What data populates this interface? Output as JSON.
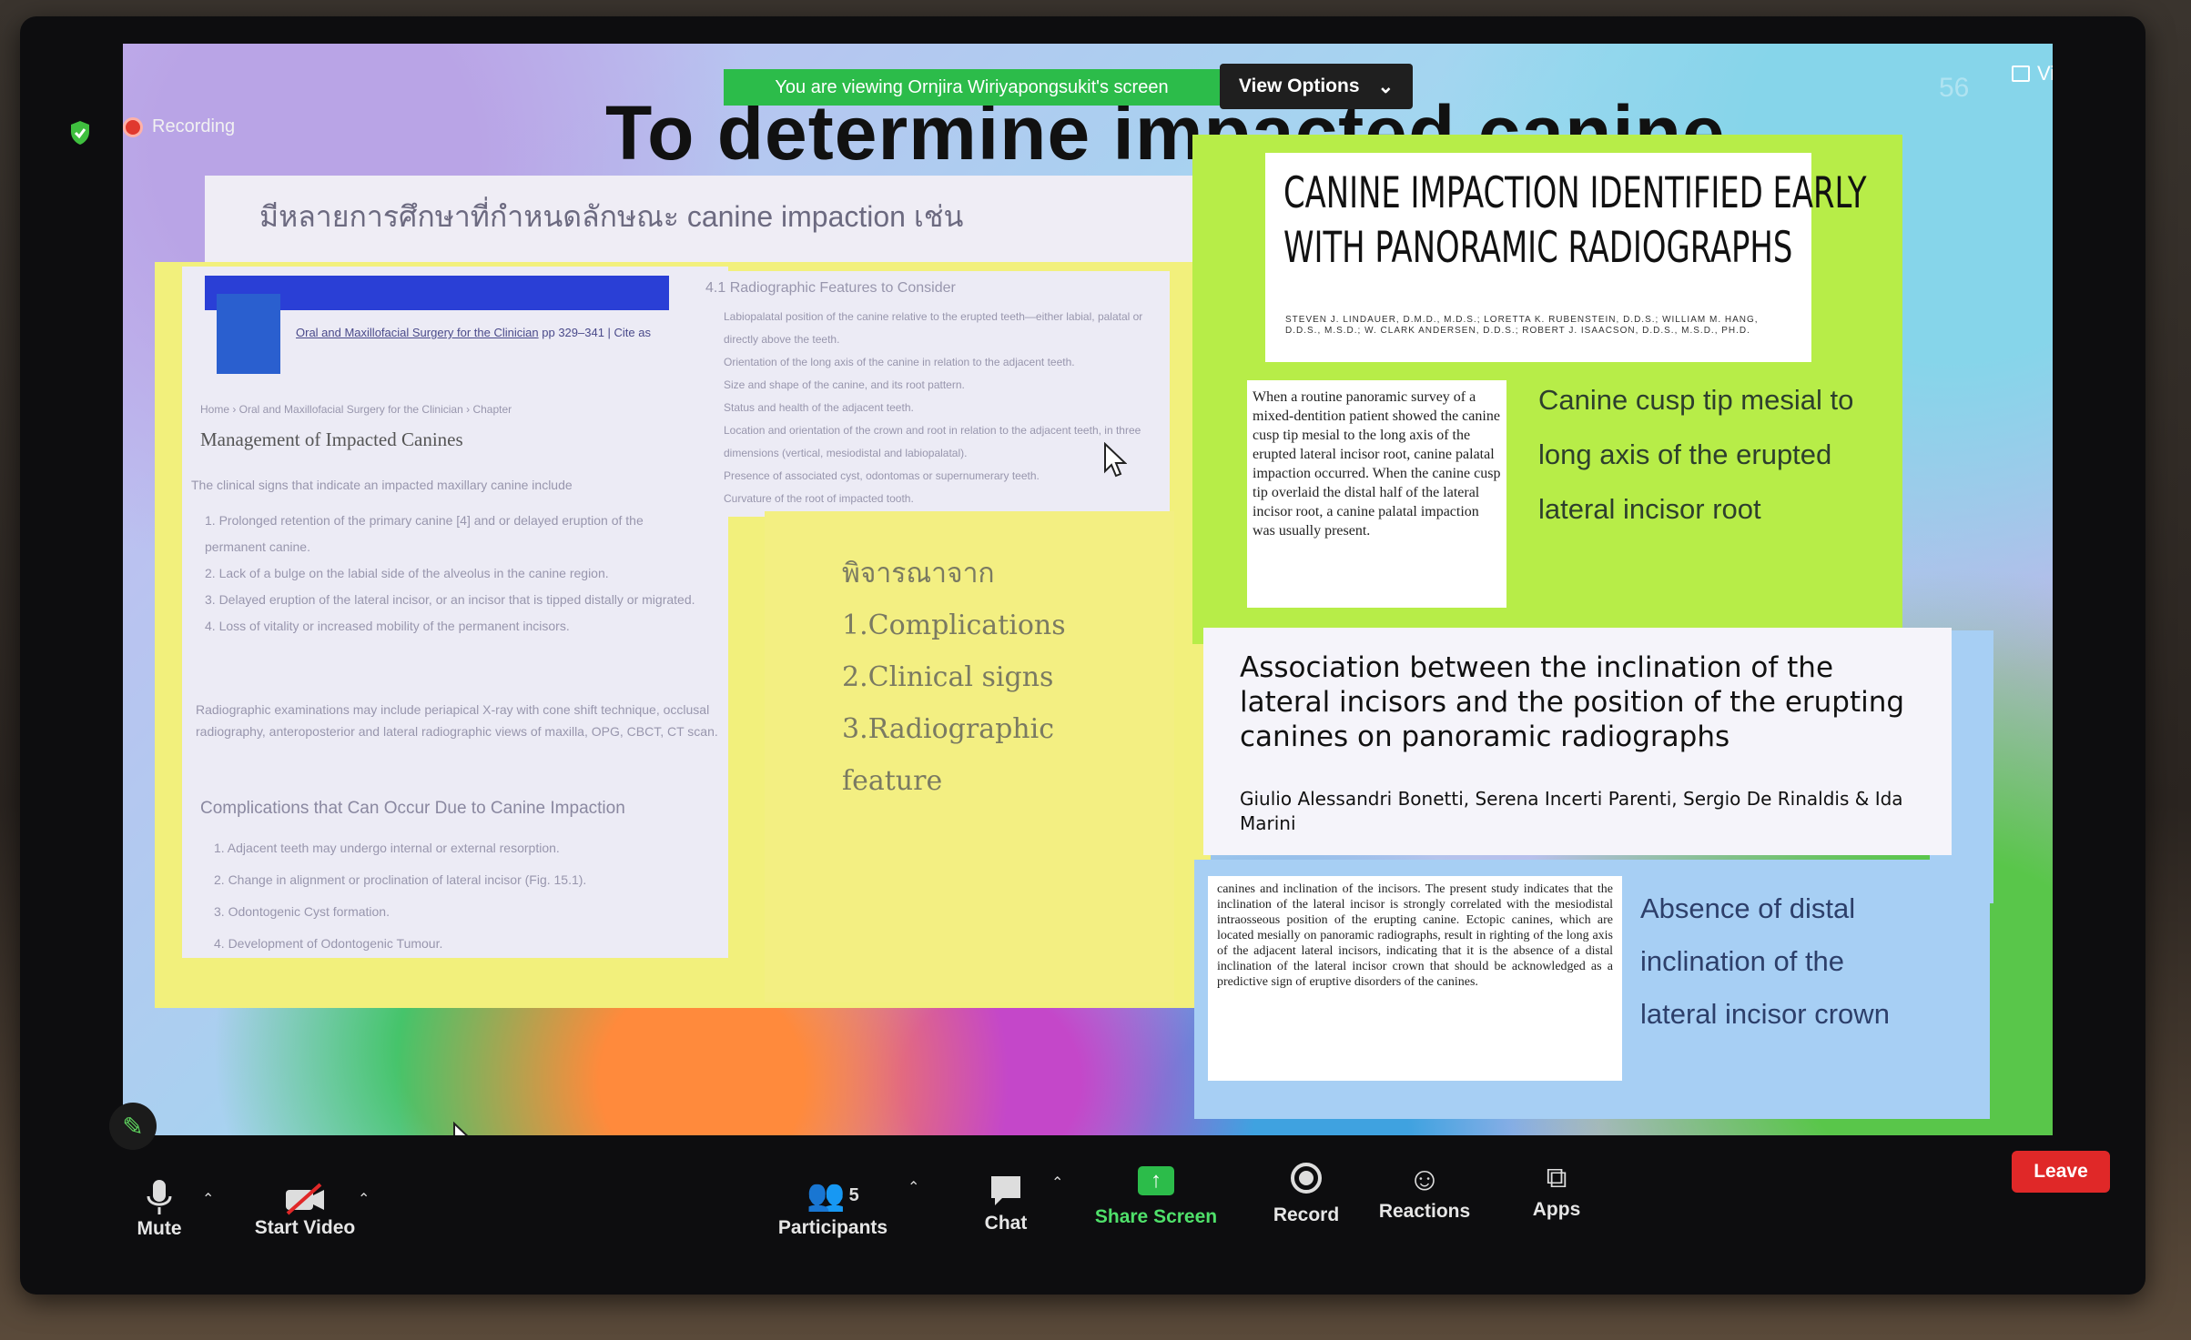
{
  "meeting": {
    "recording_label": "Recording",
    "viewing_banner": "You are viewing Ornjira Wiriyapongsukit's screen",
    "view_options_label": "View Options",
    "view_label": "View",
    "leave_label": "Leave",
    "page_number": "56"
  },
  "slide": {
    "title": "To determine impacted canine",
    "thai_heading": "มีหลายการศึกษาที่กำหนดลักษณะ canine impaction เช่น",
    "book": {
      "source": "Oral and Maxillofacial Surgery for the Clinician",
      "pages": "pp 329–341 | Cite as",
      "breadcrumb": "Home › Oral and Maxillofacial Surgery for the Clinician › Chapter",
      "chapter_title": "Management of Impacted Canines",
      "intro": "The clinical signs that indicate an impacted maxillary canine include",
      "signs": [
        "1. Prolonged retention of the primary canine [4] and or delayed eruption of the permanent canine.",
        "2. Lack of a bulge on the labial side of the alveolus in the canine region.",
        "3. Delayed eruption of the lateral incisor, or an incisor that is tipped distally or migrated.",
        "4. Loss of vitality or increased mobility of the permanent incisors."
      ],
      "radiographic": "Radiographic examinations may include periapical X-ray with cone shift technique, occlusal radiography, anteroposterior and lateral radiographic views of maxilla, OPG, CBCT, CT scan.",
      "complications_title": "Complications that Can Occur Due to Canine Impaction",
      "complications": [
        "1. Adjacent teeth may undergo internal or external resorption.",
        "2. Change in alignment or proclination of lateral incisor (Fig. 15.1).",
        "3. Odontogenic Cyst formation.",
        "4. Development of Odontogenic Tumour."
      ],
      "features_title": "4.1 Radiographic Features to Consider",
      "features": [
        "Labiopalatal position of the canine relative to the erupted teeth—either labial, palatal or directly above the teeth.",
        "Orientation of the long axis of the canine in relation to the adjacent teeth.",
        "Size and shape of the canine, and its root pattern.",
        "Status and health of the adjacent teeth.",
        "Location and orientation of the crown and root in relation to the adjacent teeth, in three dimensions (vertical, mesiodistal and labiopalatal).",
        "Presence of associated cyst, odontomas or supernumerary teeth.",
        "Curvature of the root of impacted tooth."
      ]
    },
    "consider": {
      "heading": "พิจารณาจาก",
      "items": [
        "1.Complications",
        "2.Clinical signs",
        "3.Radiographic",
        "feature"
      ]
    },
    "green": {
      "headline_line1": "CANINE IMPACTION IDENTIFIED EARLY",
      "headline_line2": "WITH PANORAMIC RADIOGRAPHS",
      "authors": "STEVEN J. LINDAUER, D.M.D., M.D.S.; LORETTA K. RUBENSTEIN, D.D.S.; WILLIAM M. HANG, D.D.S., M.S.D.; W. CLARK ANDERSEN, D.D.S.; ROBERT J. ISAACSON, D.D.S., M.S.D., PH.D.",
      "excerpt": "When a routine panoramic survey of a mixed-dentition patient showed the canine cusp tip mesial to the long axis of the erupted lateral incisor root, canine palatal impaction occurred. When the canine cusp tip overlaid the distal half of the lateral incisor root, a canine palatal impaction was usually present.",
      "note_lines": [
        "Canine cusp tip mesial to",
        "long axis of the erupted",
        "lateral incisor root"
      ]
    },
    "assoc": {
      "title": "Association between the inclination of the lateral incisors and the position of the erupting canines on panoramic radiographs",
      "authors": "Giulio Alessandri Bonetti, Serena Incerti Parenti, Sergio De Rinaldis & Ida Marini"
    },
    "blue": {
      "excerpt": "canines and inclination of the incisors. The present study indicates that the inclination of the lateral incisor is strongly correlated with the mesiodistal intraosseous position of the erupting canine. Ectopic canines, which are located mesially on panoramic radiographs, result in righting of the long axis of the adjacent lateral incisors, indicating that it is the absence of a distal inclination of the lateral incisor crown that should be acknowledged as a predictive sign of eruptive disorders of the canines.",
      "note_lines": [
        "Absence of distal",
        "inclination of the",
        "lateral incisor crown"
      ]
    }
  },
  "toolbar": {
    "mute": "Mute",
    "start_video": "Start Video",
    "participants": "Participants",
    "participants_count": "5",
    "chat": "Chat",
    "share_screen": "Share Screen",
    "record": "Record",
    "reactions": "Reactions",
    "apps": "Apps"
  },
  "colors": {
    "share_green": "#2cbc4a",
    "leave_red": "#e02828",
    "slide_yellow": "#f2f07c",
    "slide_green": "#b7ed48",
    "slide_blue": "#a7cff4"
  }
}
